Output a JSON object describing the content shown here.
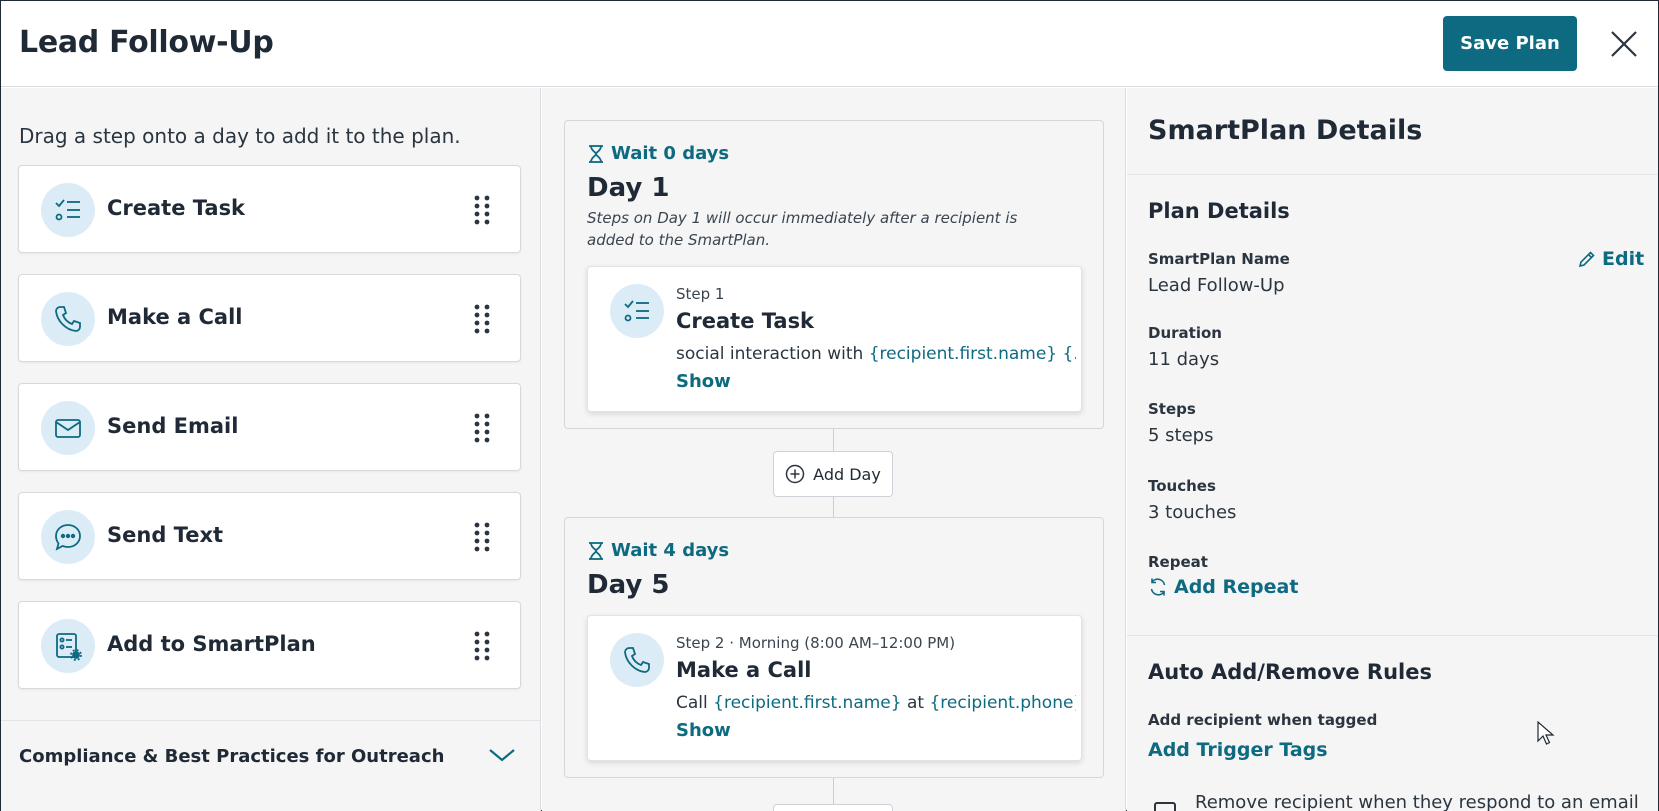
{
  "header": {
    "title": "Lead Follow-Up",
    "save_label": "Save Plan"
  },
  "left_panel": {
    "hint": "Drag a step onto a day to add it to the plan.",
    "steps": [
      {
        "label": "Create Task",
        "icon": "task-list-icon"
      },
      {
        "label": "Make a Call",
        "icon": "phone-icon"
      },
      {
        "label": "Send Email",
        "icon": "envelope-icon"
      },
      {
        "label": "Send Text",
        "icon": "chat-bubble-icon"
      },
      {
        "label": "Add to SmartPlan",
        "icon": "smartplan-icon"
      }
    ],
    "compliance": "Compliance & Best Practices for Outreach"
  },
  "timeline": {
    "add_day_label": "Add Day",
    "days": [
      {
        "wait": "Wait 0 days",
        "title": "Day 1",
        "note": "Steps on Day 1 will occur immediately after a recipient is added to the SmartPlan.",
        "step": {
          "meta": "Step 1",
          "name": "Create Task",
          "desc_prefix": "social interaction with ",
          "desc_token1": "{recipient.first.name}",
          "desc_mid": " ",
          "desc_token2": "{...",
          "show": "Show"
        }
      },
      {
        "wait": "Wait 4 days",
        "title": "Day 5",
        "step": {
          "meta": "Step 2 · Morning (8:00 AM–12:00 PM)",
          "name": "Make a Call",
          "desc_prefix": "Call ",
          "desc_token1": "{recipient.first.name}",
          "desc_mid": " at ",
          "desc_token2": "{recipient.phone}",
          "show": "Show"
        }
      }
    ]
  },
  "details": {
    "title": "SmartPlan Details",
    "plan_section": "Plan Details",
    "edit_label": "Edit",
    "fields": [
      {
        "label": "SmartPlan Name",
        "value": "Lead Follow-Up"
      },
      {
        "label": "Duration",
        "value": "11 days"
      },
      {
        "label": "Steps",
        "value": "5 steps"
      },
      {
        "label": "Touches",
        "value": "3 touches"
      }
    ],
    "repeat_label": "Repeat",
    "add_repeat": "Add Repeat",
    "rules_section": "Auto Add/Remove Rules",
    "add_when_tagged": "Add recipient when tagged",
    "add_trigger_tags": "Add Trigger Tags",
    "remove_partial": "Remove recipient when they respond to an email"
  },
  "colors": {
    "accent": "#0d6a80",
    "icon_bg": "#dcecf7",
    "panel_bg": "#f5f5f5"
  }
}
